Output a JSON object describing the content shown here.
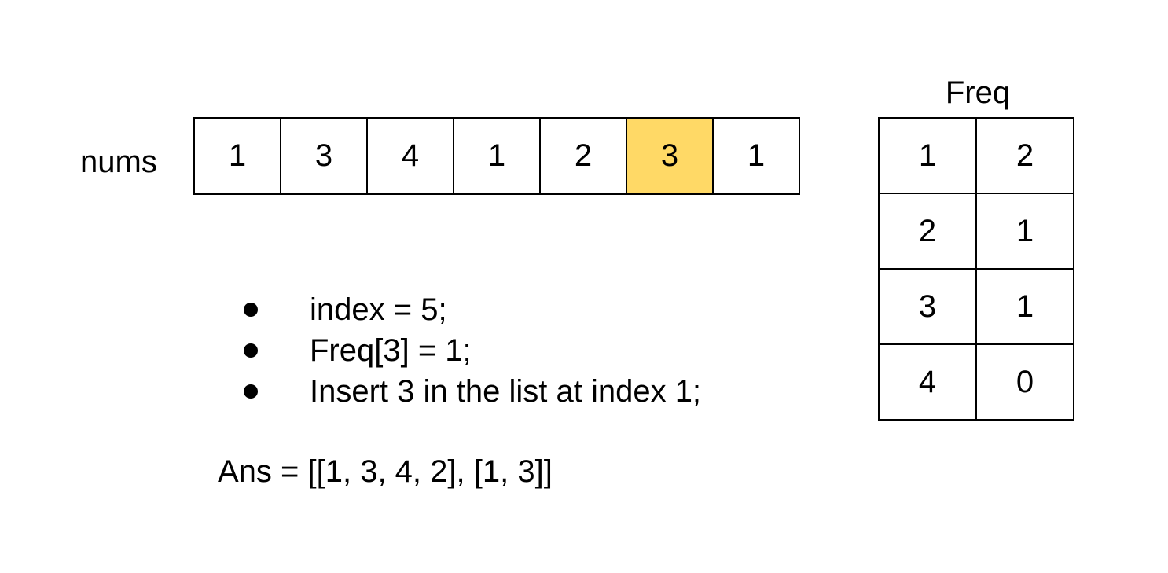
{
  "nums": {
    "label": "nums",
    "values": [
      "1",
      "3",
      "4",
      "1",
      "2",
      "3",
      "1"
    ],
    "highlight_index": 5,
    "highlight_color": "#ffd966"
  },
  "steps": [
    "index = 5;",
    "Freq[3] = 1;",
    "Insert 3 in the list at index 1;"
  ],
  "ans": "Ans = [[1, 3, 4, 2], [1, 3]]",
  "freq": {
    "title": "Freq",
    "rows": [
      {
        "key": "1",
        "value": "2"
      },
      {
        "key": "2",
        "value": "1"
      },
      {
        "key": "3",
        "value": "1"
      },
      {
        "key": "4",
        "value": "0"
      }
    ]
  }
}
